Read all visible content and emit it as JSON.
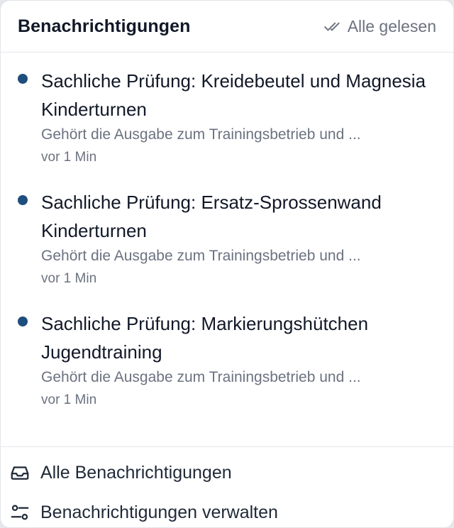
{
  "header": {
    "title": "Benachrichtigungen",
    "mark_all_read": "Alle gelesen",
    "mark_all_read_icon": "double-check-icon"
  },
  "notifications": [
    {
      "title": "Sachliche Prüfung: Kreidebeutel und Magnesia Kinderturnen",
      "description": "Gehört die Ausgabe zum Trainingsbetrieb und ...",
      "time": "vor 1 Min",
      "unread": true
    },
    {
      "title": "Sachliche Prüfung: Ersatz-Sprossenwand Kinderturnen",
      "description": "Gehört die Ausgabe zum Trainingsbetrieb und ...",
      "time": "vor 1 Min",
      "unread": true
    },
    {
      "title": "Sachliche Prüfung: Markierungshütchen Jugendtraining",
      "description": "Gehört die Ausgabe zum Trainingsbetrieb und ...",
      "time": "vor 1 Min",
      "unread": true
    }
  ],
  "footer": {
    "all_notifications": "Alle Benachrichtigungen",
    "all_notifications_icon": "inbox-icon",
    "manage_notifications": "Benachrichtigungen verwalten",
    "manage_notifications_icon": "sliders-icon"
  },
  "colors": {
    "unread_dot": "#1e4e7e",
    "muted_text": "#6b7280",
    "primary_text": "#111827"
  }
}
